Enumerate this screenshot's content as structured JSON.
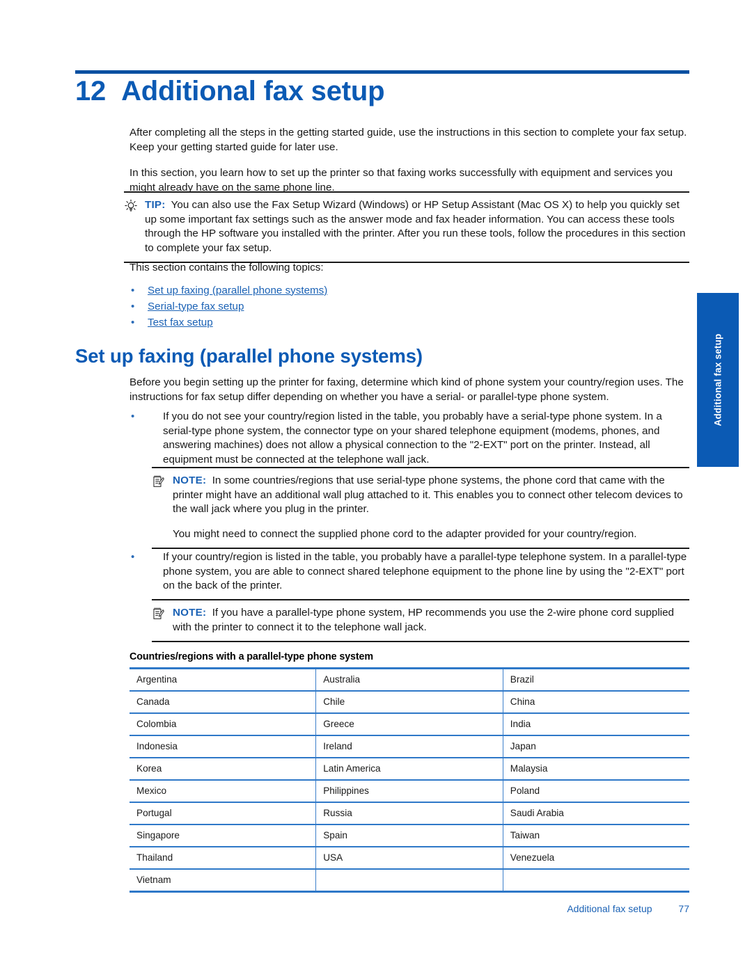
{
  "chapter": {
    "number": "12",
    "title": "Additional fax setup"
  },
  "intro": {
    "paragraph1": "After completing all the steps in the getting started guide, use the instructions in this section to complete your fax setup. Keep your getting started guide for later use.",
    "paragraph2": "In this section, you learn how to set up the printer so that faxing works successfully with equipment and services you might already have on the same phone line."
  },
  "tip_box": {
    "icon": "lightbulb-icon",
    "label": "TIP:",
    "text": "You can also use the Fax Setup Wizard (Windows) or HP Setup Assistant (Mac OS X) to help you quickly set up some important fax settings such as the answer mode and fax header information. You can access these tools through the HP software you installed with the printer. After you run these tools, follow the procedures in this section to complete your fax setup."
  },
  "toc": {
    "lead_in": "This section contains the following topics:",
    "bullet": "•",
    "links": [
      "Set up faxing (parallel phone systems)",
      "Serial-type fax setup",
      "Test fax setup"
    ]
  },
  "section": {
    "heading": "Set up faxing (parallel phone systems)",
    "intro": "Before you begin setting up the printer for faxing, determine which kind of phone system your country/region uses. The instructions for fax setup differ depending on whether you have a serial- or parallel-type phone system.",
    "bullet_serial": "If you do not see your country/region listed in the table, you probably have a serial-type phone system. In a serial-type phone system, the connector type on your shared telephone equipment (modems, phones, and answering machines) does not allow a physical connection to the \"2-EXT\" port on the printer. Instead, all equipment must be connected at the telephone wall jack.",
    "bullet_parallel": "If your country/region is listed in the table, you probably have a parallel-type telephone system. In a parallel-type phone system, you are able to connect shared telephone equipment to the phone line by using the \"2-EXT\" port on the back of the printer."
  },
  "note_box_1": {
    "icon": "note-icon",
    "label": "NOTE:",
    "text": "In some countries/regions that use serial-type phone systems, the phone cord that came with the printer might have an additional wall plug attached to it. This enables you to connect other telecom devices to the wall jack where you plug in the printer.",
    "text2": "You might need to connect the supplied phone cord to the adapter provided for your country/region."
  },
  "note_box_2": {
    "icon": "note-icon",
    "label": "NOTE:",
    "text": "If you have a parallel-type phone system, HP recommends you use the 2-wire phone cord supplied with the printer to connect it to the telephone wall jack."
  },
  "table": {
    "caption": "Countries/regions with a parallel-type phone system",
    "rows": [
      [
        "Argentina",
        "Australia",
        "Brazil"
      ],
      [
        "Canada",
        "Chile",
        "China"
      ],
      [
        "Colombia",
        "Greece",
        "India"
      ],
      [
        "Indonesia",
        "Ireland",
        "Japan"
      ],
      [
        "Korea",
        "Latin America",
        "Malaysia"
      ],
      [
        "Mexico",
        "Philippines",
        "Poland"
      ],
      [
        "Portugal",
        "Russia",
        "Saudi Arabia"
      ],
      [
        "Singapore",
        "Spain",
        "Taiwan"
      ],
      [
        "Thailand",
        "USA",
        "Venezuela"
      ],
      [
        "Vietnam",
        "",
        ""
      ]
    ]
  },
  "side_tab": {
    "label": "Additional fax setup"
  },
  "footer": {
    "title": "Additional fax setup",
    "page": "77"
  },
  "colors": {
    "brand_blue": "#0B5AB4",
    "link_blue": "#1B62B5",
    "table_rule": "#2E78C8",
    "text": "#181818"
  }
}
